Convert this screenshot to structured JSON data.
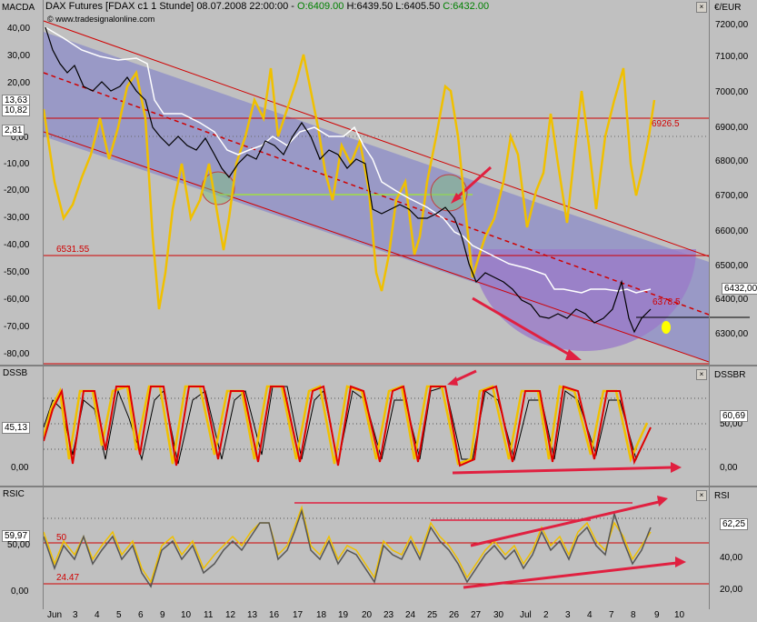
{
  "header": {
    "indicator_left": "MACDA",
    "instrument": "DAX Futures [FDAX c1  1 Stunde]",
    "datetime": "08.07.2008 22:00:00 -",
    "open": "O:6409.00",
    "high": "H:6439.50",
    "low": "L:6405.50",
    "close": "C:6432.00",
    "source": "www.tradesignalonline.com",
    "currency": "€/EUR"
  },
  "price_panel": {
    "right_ticks": [
      "7200,00",
      "7100,00",
      "7000,00",
      "6900,00",
      "6800,00",
      "6700,00",
      "6600,00",
      "6500,00",
      "6400,00",
      "6300,00"
    ],
    "left_ticks": [
      "40,00",
      "30,00",
      "20,00",
      "10,00",
      "0,00",
      "-10,00",
      "-20,00",
      "-30,00",
      "-40,00",
      "-50,00",
      "-60,00",
      "-70,00",
      "-80,00"
    ],
    "left_values": [
      "13,63",
      "10,82",
      "2,81"
    ],
    "last_price": "6432,00",
    "level_6926": "6926.5",
    "level_6531": "6531.55",
    "level_6378": "6378.5",
    "colors": {
      "price": "#000000",
      "overlay": "#ffffff",
      "macd": "#f0c000",
      "channel": "#d00000",
      "fill": "#8c8cc8"
    }
  },
  "dss_panel": {
    "left_label": "DSSB",
    "right_label": "DSSBR",
    "left_ticks": [
      "0,00"
    ],
    "left_value": "45,13",
    "right_ticks": [
      "50,00",
      "0,00"
    ],
    "right_value": "60,69"
  },
  "rsi_panel": {
    "left_label": "RSIC",
    "right_label": "RSI",
    "left_ticks": [
      "50,00",
      "0,00"
    ],
    "left_value": "59,97",
    "right_ticks": [
      "40,00",
      "20,00"
    ],
    "right_value": "62,25",
    "level_50": "50",
    "level_24": "24.47"
  },
  "x_axis": {
    "labels": [
      "Jun",
      "3",
      "4",
      "5",
      "6",
      "9",
      "10",
      "11",
      "12",
      "13",
      "16",
      "17",
      "18",
      "19",
      "20",
      "23",
      "24",
      "25",
      "26",
      "27",
      "30",
      "Jul",
      "2",
      "3",
      "4",
      "7",
      "8",
      "9",
      "10"
    ]
  }
}
